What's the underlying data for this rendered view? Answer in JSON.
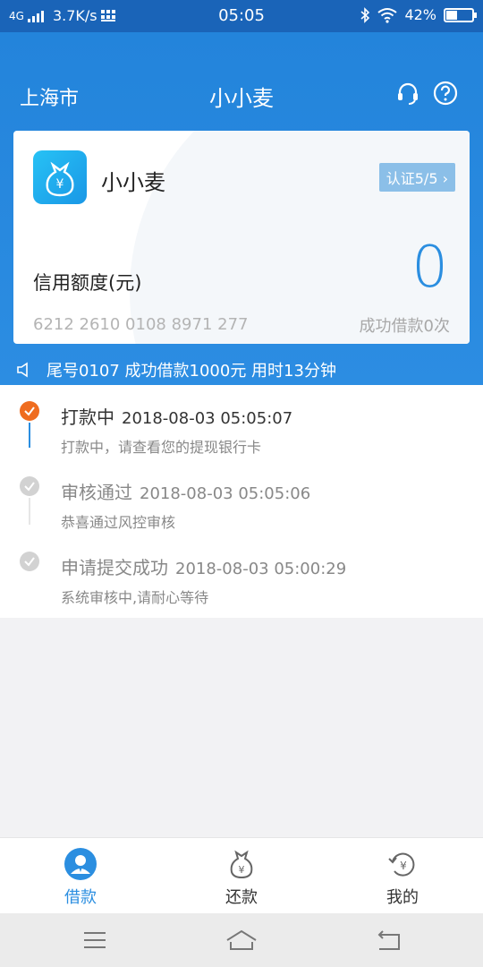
{
  "status_bar": {
    "network": "4G",
    "speed": "3.7K/s",
    "time": "05:05",
    "battery": "42%",
    "battery_level": 0.42,
    "icons": [
      "signal-icon",
      "bluetooth-icon",
      "wifi-icon",
      "battery-icon"
    ]
  },
  "header": {
    "city": "上海市",
    "title": "小小麦",
    "icons": [
      "headset-icon",
      "help-icon"
    ]
  },
  "card": {
    "name": "小小麦",
    "cert_badge": "认证5/5",
    "credit_label": "信用额度(元)",
    "credit_value": "0",
    "card_number": "6212 2610 0108 8971 277",
    "success_count": "成功借款0次"
  },
  "notice": {
    "text": "尾号0107 成功借款1000元 用时13分钟"
  },
  "timeline": [
    {
      "title": "打款中",
      "time": "2018-08-03 05:05:07",
      "desc": "打款中，请查看您的提现银行卡",
      "status": "active"
    },
    {
      "title": "审核通过",
      "time": "2018-08-03 05:05:06",
      "desc": "恭喜通过风控审核",
      "status": "done"
    },
    {
      "title": "申请提交成功",
      "time": "2018-08-03 05:00:29",
      "desc": "系统审核中,请耐心等待",
      "status": "done"
    }
  ],
  "bottom_nav": [
    {
      "label": "借款",
      "icon": "borrow-icon",
      "active": true
    },
    {
      "label": "还款",
      "icon": "money-bag-icon",
      "active": false
    },
    {
      "label": "我的",
      "icon": "refresh-yen-icon",
      "active": false
    }
  ],
  "colors": {
    "primary": "#2b8ee0",
    "header": "#2384db",
    "status_bar": "#1a64b8",
    "active_dot": "#ef6c1f",
    "done_dot": "#cccccc"
  }
}
